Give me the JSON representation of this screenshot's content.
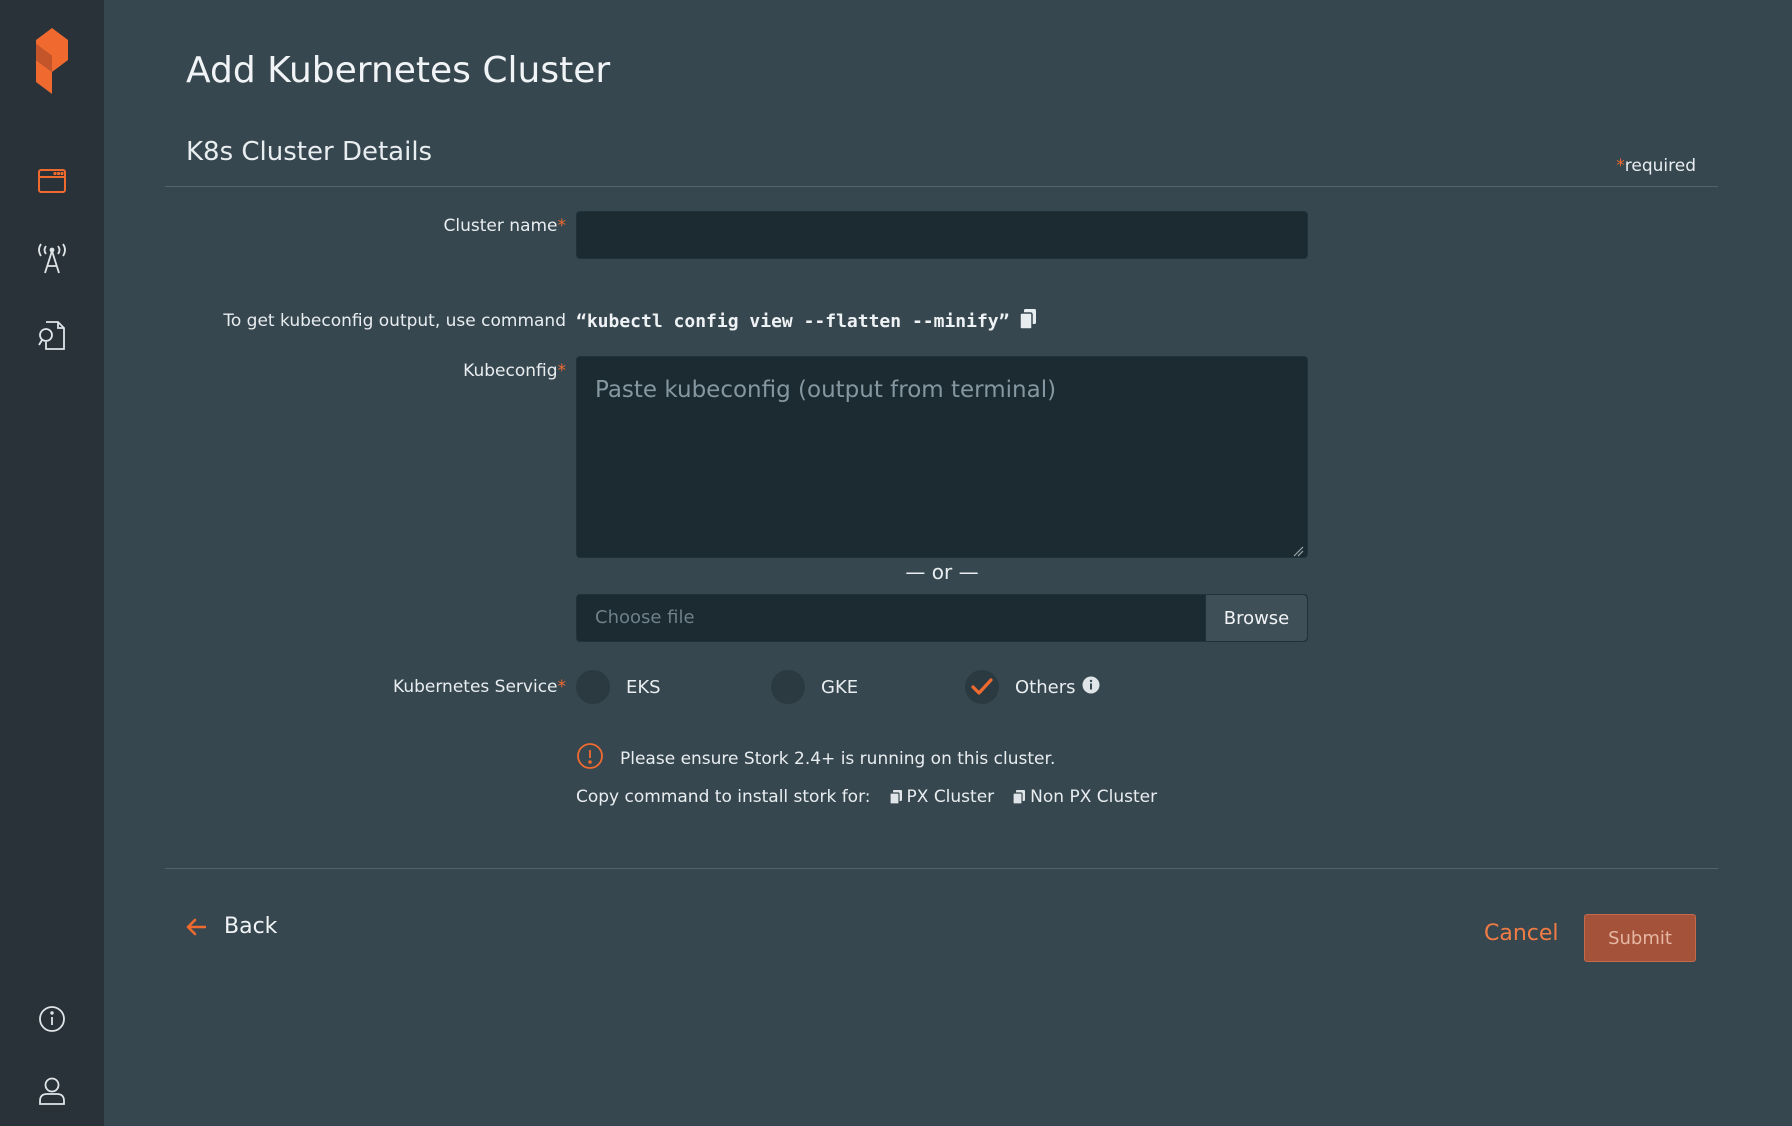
{
  "colors": {
    "accent": "#f06a30",
    "sidebar_bg": "#283238",
    "page_bg": "#37474f",
    "input_bg": "#1c2a31"
  },
  "sidebar": {
    "icons": [
      "logo-icon",
      "browser-window-icon",
      "broadcast-tower-icon",
      "document-search-icon",
      "info-icon",
      "user-icon"
    ]
  },
  "header": {
    "title": "Add Kubernetes Cluster"
  },
  "section": {
    "title": "K8s Cluster Details",
    "required_star": "*",
    "required_note": "required"
  },
  "form": {
    "cluster_name": {
      "label": "Cluster name",
      "star": "*",
      "value": ""
    },
    "kubeconfig_hint": {
      "label": "To get kubeconfig output, use command",
      "command": "“kubectl config view --flatten --minify”"
    },
    "kubeconfig": {
      "label": "Kubeconfig",
      "star": "*",
      "placeholder": "Paste kubeconfig (output from terminal)",
      "value": ""
    },
    "separator": "— or —",
    "file": {
      "placeholder": "Choose file",
      "browse_label": "Browse"
    },
    "service": {
      "label": "Kubernetes Service",
      "star": "*",
      "options": [
        {
          "label": "EKS",
          "selected": false
        },
        {
          "label": "GKE",
          "selected": false
        },
        {
          "label": "Others",
          "selected": true
        }
      ]
    },
    "stork_notice": "Please ensure Stork 2.4+ is running on this cluster.",
    "stork_copy_label": "Copy command to install stork for:",
    "stork_links": [
      "PX Cluster",
      "Non PX Cluster"
    ]
  },
  "footer": {
    "back_label": "Back",
    "cancel_label": "Cancel",
    "submit_label": "Submit"
  }
}
